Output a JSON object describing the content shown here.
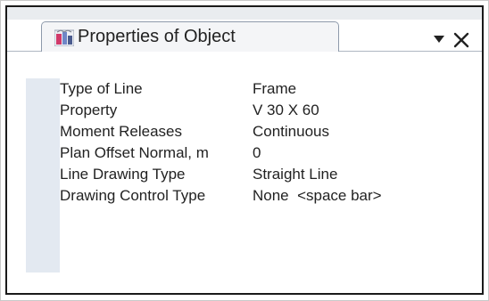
{
  "panel": {
    "title": "Properties of Object",
    "dropdown_icon": "chevron-down-icon",
    "close_icon": "close-icon",
    "tab_icon": "properties-icon"
  },
  "properties": [
    {
      "name": "Type of Line",
      "value": "Frame"
    },
    {
      "name": "Property",
      "value": "V 30 X 60"
    },
    {
      "name": "Moment Releases",
      "value": "Continuous"
    },
    {
      "name": "Plan Offset Normal, m",
      "value": "0"
    },
    {
      "name": "Line Drawing Type",
      "value": "Straight Line"
    },
    {
      "name": "Drawing Control Type",
      "value": "None  <space bar>"
    }
  ],
  "colors": {
    "gutter": "#e3e9f1",
    "tab_border": "#8e9aab",
    "panel_border": "#1a1a1a"
  }
}
